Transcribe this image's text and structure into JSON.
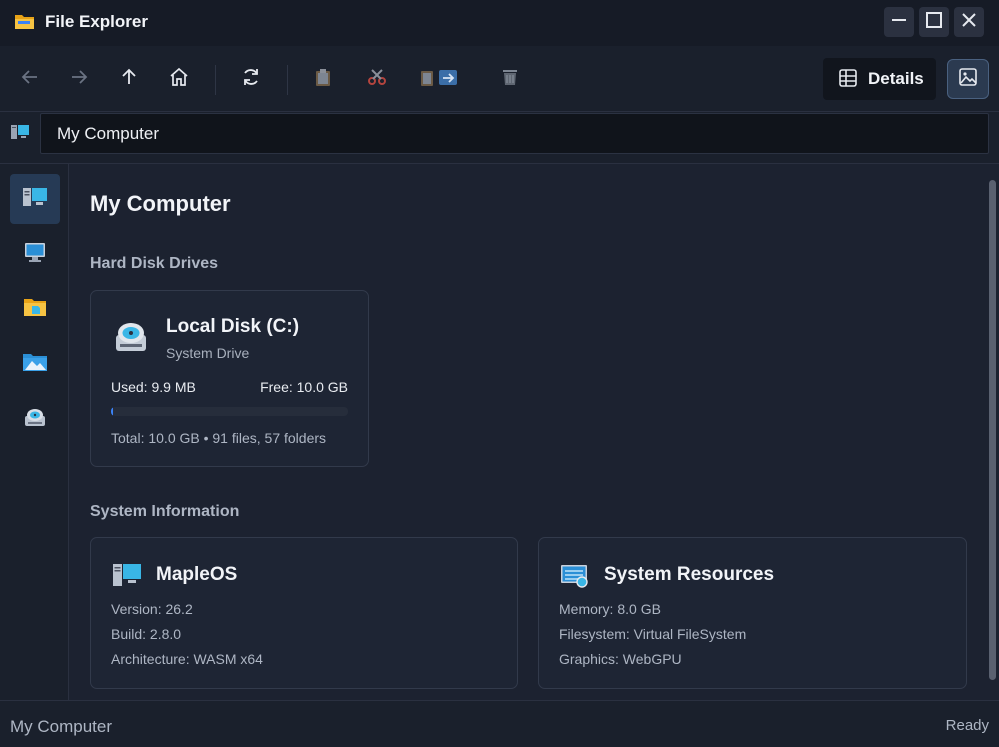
{
  "window": {
    "title": "File Explorer",
    "accent": "#3b82f6"
  },
  "toolbar": {
    "buttons": [
      {
        "name": "back-button",
        "icon": "arrow-left-icon"
      },
      {
        "name": "forward-button",
        "icon": "arrow-right-icon"
      },
      {
        "name": "up-button",
        "icon": "arrow-up-icon"
      },
      {
        "name": "home-button",
        "icon": "home-icon"
      },
      {
        "name": "refresh-button",
        "icon": "refresh-icon"
      },
      {
        "name": "copy-button",
        "icon": "clipboard-icon"
      },
      {
        "name": "cut-button",
        "icon": "scissors-icon"
      },
      {
        "name": "paste-button",
        "icon": "paste-icon"
      },
      {
        "name": "delete-button",
        "icon": "trash-icon"
      }
    ],
    "details_label": "Details"
  },
  "address": {
    "value": "My Computer"
  },
  "sidebar": {
    "items": [
      {
        "name": "my-computer",
        "icon": "computer-icon",
        "active": true
      },
      {
        "name": "desktop",
        "icon": "monitor-icon",
        "active": false
      },
      {
        "name": "documents",
        "icon": "folder-icon",
        "active": false
      },
      {
        "name": "pictures",
        "icon": "pictures-icon",
        "active": false
      },
      {
        "name": "disk",
        "icon": "disk-icon",
        "active": false
      }
    ]
  },
  "main": {
    "title": "My Computer",
    "drives_heading": "Hard Disk Drives",
    "drive": {
      "name": "Local Disk (C:)",
      "subtitle": "System Drive",
      "used": "Used: 9.9 MB",
      "free": "Free: 10.0 GB",
      "usage_fraction": 0.001,
      "total": "Total: 10.0 GB • 91 files, 57 folders"
    },
    "system_heading": "System Information",
    "os": {
      "name": "MapleOS",
      "version": "Version: 26.2",
      "build": "Build: 2.8.0",
      "architecture": "Architecture: WASM x64"
    },
    "resources": {
      "name": "System Resources",
      "memory": "Memory: 8.0 GB",
      "filesystem": "Filesystem: Virtual FileSystem",
      "graphics": "Graphics: WebGPU"
    }
  },
  "status": {
    "left": "My Computer",
    "right": "Ready"
  }
}
